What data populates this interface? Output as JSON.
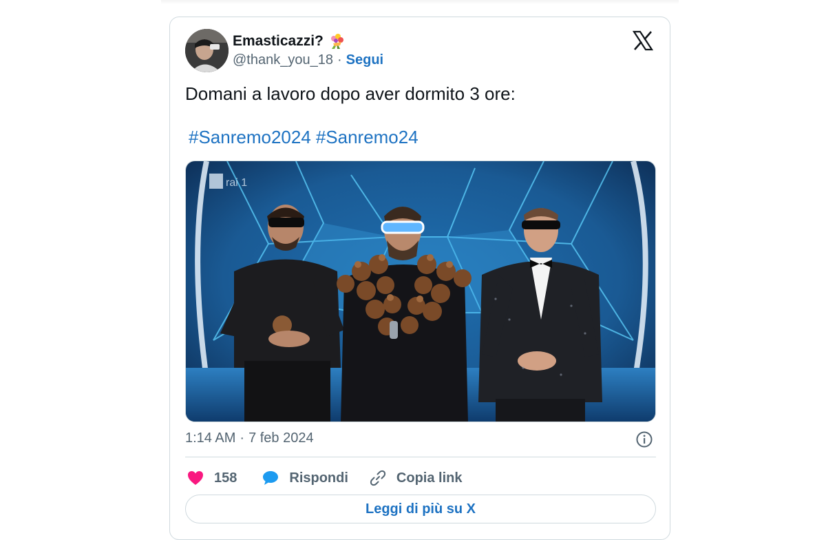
{
  "tweet": {
    "author_name": "Emasticazzi?",
    "author_emoji": "bouquet-emoji",
    "handle": "@thank_you_18",
    "separator": "·",
    "follow_label": "Segui",
    "text": "Domani a lavoro dopo aver dormito 3 ore:",
    "hashtags": [
      "#Sanremo2024",
      "#Sanremo24"
    ],
    "media_logo_text": "rai 1",
    "time": "1:14 AM",
    "date": "7 feb 2024",
    "likes": "158",
    "reply_label": "Rispondi",
    "copy_link_label": "Copia link",
    "read_more_label": "Leggi di più su X"
  },
  "icons": {
    "platform": "x-logo-icon",
    "info": "info-icon",
    "like": "heart-icon",
    "reply": "speech-bubble-icon",
    "copy": "link-icon"
  },
  "colors": {
    "link": "#1d72c2",
    "like": "#f91880",
    "reply": "#1d9bf0",
    "secondary_text": "#536471",
    "border": "#cfd9de"
  }
}
